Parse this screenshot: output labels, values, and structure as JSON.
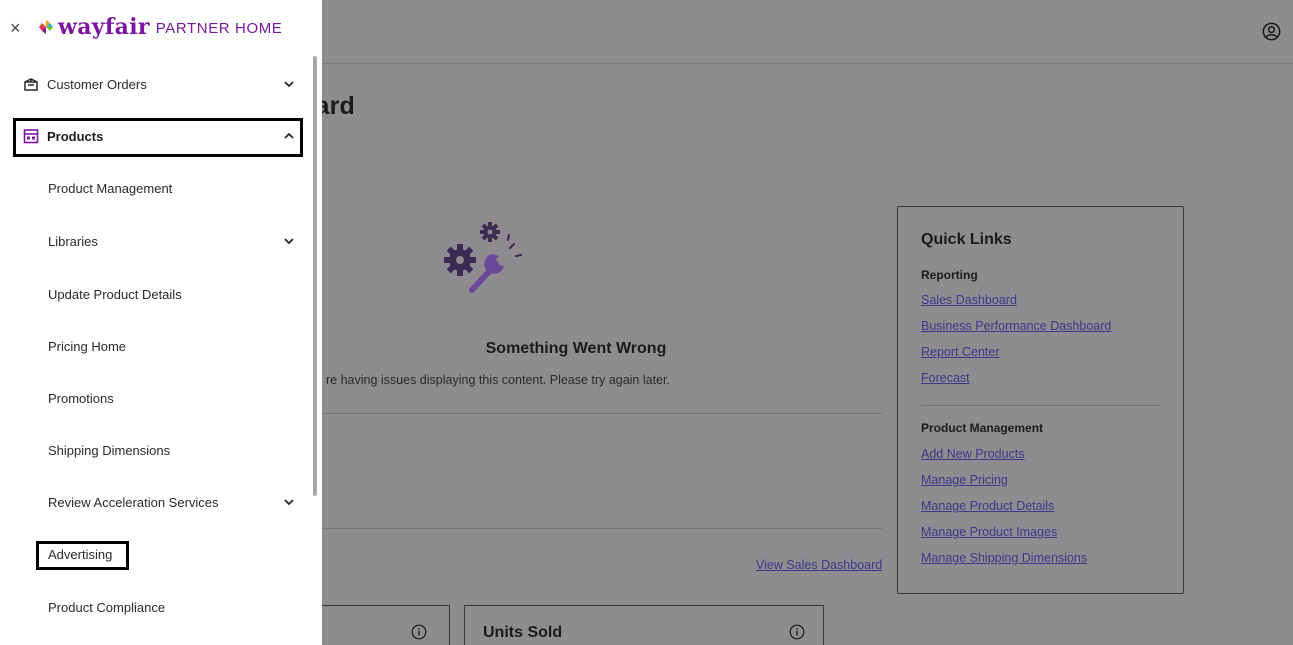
{
  "header": {
    "close_symbol": "×",
    "logo_word": "wayfair",
    "logo_sub": "PARTNER HOME",
    "profile_icon": "user-circle-icon"
  },
  "sidebar": {
    "items": [
      {
        "label": "Customer Orders",
        "icon": "package-icon",
        "chevron": "down"
      },
      {
        "label": "Products",
        "icon": "storefront-icon",
        "chevron": "up",
        "expanded": true,
        "highlighted": true
      },
      {
        "label": "Product Management"
      },
      {
        "label": "Libraries",
        "chevron": "down"
      },
      {
        "label": "Update Product Details"
      },
      {
        "label": "Pricing Home"
      },
      {
        "label": "Promotions"
      },
      {
        "label": "Shipping Dimensions"
      },
      {
        "label": "Review Acceleration Services",
        "chevron": "down"
      },
      {
        "label": "Advertising",
        "highlighted": true
      },
      {
        "label": "Product Compliance"
      }
    ]
  },
  "main": {
    "title_fragment": "oard",
    "error": {
      "title": "Something Went Wrong",
      "message": "re having issues displaying this content. Please try again later."
    },
    "view_sales_link": "View Sales Dashboard",
    "cards": [
      {
        "title": ""
      },
      {
        "title": "Units Sold"
      }
    ]
  },
  "quick_links": {
    "title": "Quick Links",
    "sections": [
      {
        "heading": "Reporting",
        "links": [
          "Sales Dashboard",
          "Business Performance Dashboard",
          "Report Center",
          "Forecast"
        ]
      },
      {
        "heading": "Product Management",
        "links": [
          "Add New Products",
          "Manage Pricing",
          "Manage Product Details",
          "Manage Product Images",
          "Manage Shipping Dimensions"
        ]
      }
    ]
  },
  "colors": {
    "brand": "#7b189f",
    "overlay": "#8e8c8e",
    "link": "#3c3a8a"
  }
}
